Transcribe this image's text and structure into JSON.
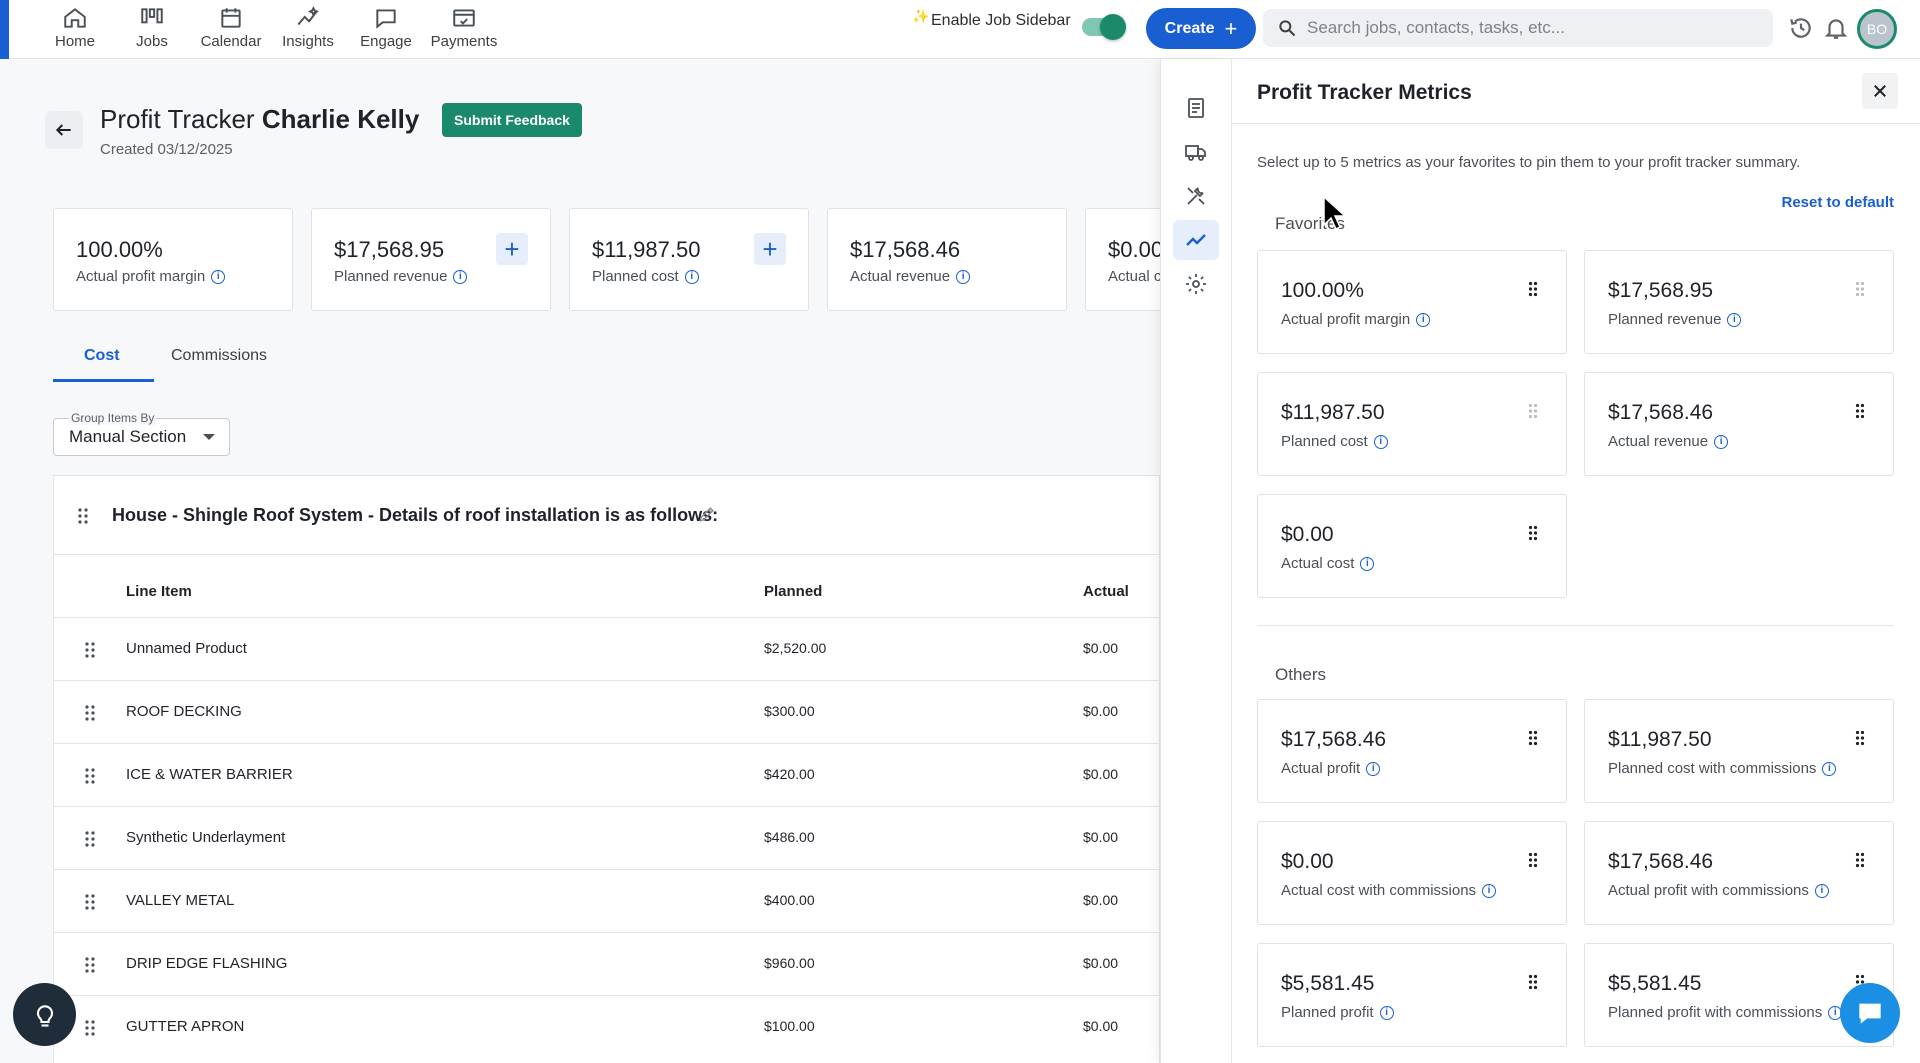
{
  "nav": {
    "items": [
      {
        "label": "Home",
        "icon": "home-icon"
      },
      {
        "label": "Jobs",
        "icon": "jobs-icon"
      },
      {
        "label": "Calendar",
        "icon": "calendar-icon"
      },
      {
        "label": "Insights",
        "icon": "insights-icon"
      },
      {
        "label": "Engage",
        "icon": "engage-icon"
      },
      {
        "label": "Payments",
        "icon": "payments-icon"
      }
    ],
    "sidebar_toggle_label": "Enable Job Sidebar",
    "sidebar_toggle_on": true,
    "create_label": "Create",
    "search_placeholder": "Search jobs, contacts, tasks, etc...",
    "avatar_initials": "BO"
  },
  "page": {
    "title_prefix": "Profit Tracker",
    "title_name": "Charlie Kelly",
    "created": "Created 03/12/2025",
    "feedback_label": "Submit Feedback",
    "summary": [
      {
        "value": "100.00%",
        "label": "Actual profit margin"
      },
      {
        "value": "$17,568.95",
        "label": "Planned revenue"
      },
      {
        "value": "$11,987.50",
        "label": "Planned cost"
      },
      {
        "value": "$17,568.46",
        "label": "Actual revenue"
      },
      {
        "value": "$0.00",
        "label": "Actual cost"
      }
    ],
    "tabs": [
      {
        "label": "Cost",
        "active": true
      },
      {
        "label": "Commissions",
        "active": false
      }
    ],
    "group_by": {
      "caption": "Group Items By",
      "value": "Manual Section"
    },
    "section": {
      "title": "House - Shingle Roof System - Details of roof installation is as follows:",
      "columns": [
        "Line Item",
        "Planned",
        "Actual"
      ],
      "rows": [
        {
          "name": "Unnamed Product",
          "planned": "$2,520.00",
          "actual": "$0.00"
        },
        {
          "name": "ROOF DECKING",
          "planned": "$300.00",
          "actual": "$0.00"
        },
        {
          "name": "ICE & WATER BARRIER",
          "planned": "$420.00",
          "actual": "$0.00"
        },
        {
          "name": "Synthetic Underlayment",
          "planned": "$486.00",
          "actual": "$0.00"
        },
        {
          "name": "VALLEY METAL",
          "planned": "$400.00",
          "actual": "$0.00"
        },
        {
          "name": "DRIP EDGE FLASHING",
          "planned": "$960.00",
          "actual": "$0.00"
        },
        {
          "name": "GUTTER APRON",
          "planned": "$100.00",
          "actual": "$0.00"
        }
      ]
    }
  },
  "drawer": {
    "title": "Profit Tracker Metrics",
    "description": "Select up to 5 metrics as your favorites to pin them to your profit tracker summary.",
    "reset_label": "Reset to default",
    "favorites_label": "Favorites",
    "others_label": "Others",
    "favorites": [
      {
        "value": "100.00%",
        "label": "Actual profit margin"
      },
      {
        "value": "$17,568.95",
        "label": "Planned revenue"
      },
      {
        "value": "$11,987.50",
        "label": "Planned cost"
      },
      {
        "value": "$17,568.46",
        "label": "Actual revenue"
      },
      {
        "value": "$0.00",
        "label": "Actual cost"
      }
    ],
    "others": [
      {
        "value": "$17,568.46",
        "label": "Actual profit"
      },
      {
        "value": "$11,987.50",
        "label": "Planned cost with commissions"
      },
      {
        "value": "$0.00",
        "label": "Actual cost with commissions"
      },
      {
        "value": "$17,568.46",
        "label": "Actual profit with commissions"
      },
      {
        "value": "$5,581.45",
        "label": "Planned profit"
      },
      {
        "value": "$5,581.45",
        "label": "Planned profit with commissions"
      }
    ]
  },
  "colors": {
    "accent": "#1a5fd1",
    "brand_green": "#1b8a6b"
  }
}
